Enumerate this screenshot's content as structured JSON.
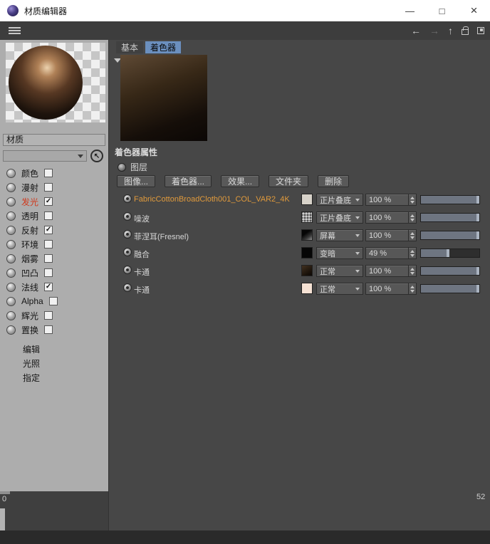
{
  "colors": {
    "channel_active": "#cf3a1e",
    "layer_accent": "#e09a3c",
    "tab_active_bg": "#6b8fbe",
    "slider_fill": "#6e7581",
    "slider_handle": "#aab3c0"
  },
  "window": {
    "title": "材质编辑器",
    "minimize": "—",
    "maximize": "□",
    "close": "×"
  },
  "toolbar": {
    "back": "←",
    "forward": "→",
    "up": "↑"
  },
  "left_panel": {
    "material_name": "材质",
    "picker_glyph": "↖",
    "channels": [
      {
        "label": "颜色",
        "check": ""
      },
      {
        "label": "漫射",
        "check": ""
      },
      {
        "label": "发光",
        "check": "✓",
        "active": true
      },
      {
        "label": "透明",
        "check": ""
      },
      {
        "label": "反射",
        "check": "✓"
      },
      {
        "label": "环境",
        "check": ""
      },
      {
        "label": "烟雾",
        "check": ""
      },
      {
        "label": "凹凸",
        "check": ""
      },
      {
        "label": "法线",
        "check": "✓"
      },
      {
        "label": "Alpha",
        "check": ""
      },
      {
        "label": "辉光",
        "check": ""
      },
      {
        "label": "置换",
        "check": ""
      }
    ],
    "footer_items": [
      {
        "label": "编辑"
      },
      {
        "label": "光照"
      },
      {
        "label": "指定"
      }
    ]
  },
  "shader_panel": {
    "tabs": [
      {
        "label": "基本"
      },
      {
        "label": "着色器"
      }
    ],
    "active_tab": "着色器",
    "section_title": "着色器属性",
    "layer_type_label": "图层",
    "buttons": [
      {
        "label": "图像..."
      },
      {
        "label": "着色器..."
      },
      {
        "label": "效果..."
      },
      {
        "label": "文件夹"
      },
      {
        "label": "删除"
      }
    ],
    "layers": [
      {
        "name": "FabricCottonBroadCloth001_COL_VAR2_4K",
        "blend": "正片叠底",
        "amount": "100 %",
        "percent": 100,
        "thumb": "flat-light",
        "accent": true
      },
      {
        "name": "噪波",
        "blend": "正片叠底",
        "amount": "100 %",
        "percent": 100,
        "thumb": "noise"
      },
      {
        "name": "菲涅耳(Fresnel)",
        "blend": "屏幕",
        "amount": "100 %",
        "percent": 100,
        "thumb": "fresnel"
      },
      {
        "name": "融合",
        "blend": "变暗",
        "amount": "49 %",
        "percent": 49,
        "thumb": "black"
      },
      {
        "name": "卡通",
        "blend": "正常",
        "amount": "100 %",
        "percent": 100,
        "thumb": "brown"
      },
      {
        "name": "卡通",
        "blend": "正常",
        "amount": "100 %",
        "percent": 100,
        "thumb": "cream"
      }
    ]
  },
  "bottom": {
    "left_number": "0",
    "right_number": "52"
  }
}
